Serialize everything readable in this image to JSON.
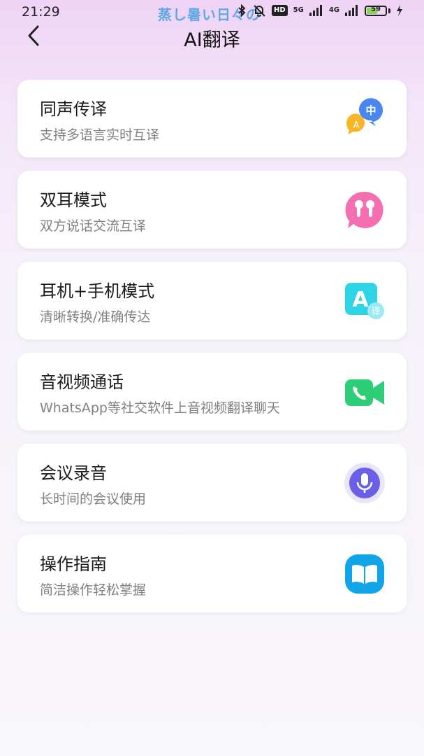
{
  "status_bar": {
    "time": "21:29",
    "marquee": "蒸し暑い日々の",
    "hd_label": "HD",
    "net_label_1": "5G",
    "net_label_2": "4G",
    "battery_level": "59",
    "battery_fraction": 0.59
  },
  "header": {
    "title": "AI翻译"
  },
  "menu": [
    {
      "title": "同声传译",
      "subtitle": "支持多语言实时互译",
      "icon": "bilingual-chat-icon",
      "icon_text_a": "A",
      "icon_text_b": "中"
    },
    {
      "title": "双耳模式",
      "subtitle": "双方说话交流互译",
      "icon": "earbuds-icon"
    },
    {
      "title": "耳机+手机模式",
      "subtitle": "清晰转换/准确传达",
      "icon": "translate-badge-icon",
      "icon_text_a": "A",
      "icon_text_b": "译"
    },
    {
      "title": "音视频通话",
      "subtitle": "WhatsApp等社交软件上音视频翻译聊天",
      "icon": "video-call-icon"
    },
    {
      "title": "会议录音",
      "subtitle": "长时间的会议使用",
      "icon": "microphone-icon"
    },
    {
      "title": "操作指南",
      "subtitle": "简洁操作轻松掌握",
      "icon": "book-icon"
    }
  ],
  "colors": {
    "bg_top": "#efd3f6",
    "bg_bottom": "#f8f7fb",
    "chat_blue": "#4a86f0",
    "chat_yellow": "#f8b626",
    "earbuds_pink": "#f46fb0",
    "translate_cyan": "#2fd3e6",
    "video_green": "#2ecd78",
    "mic_purple": "#6b5fe8",
    "book_blue": "#10a5e8"
  }
}
